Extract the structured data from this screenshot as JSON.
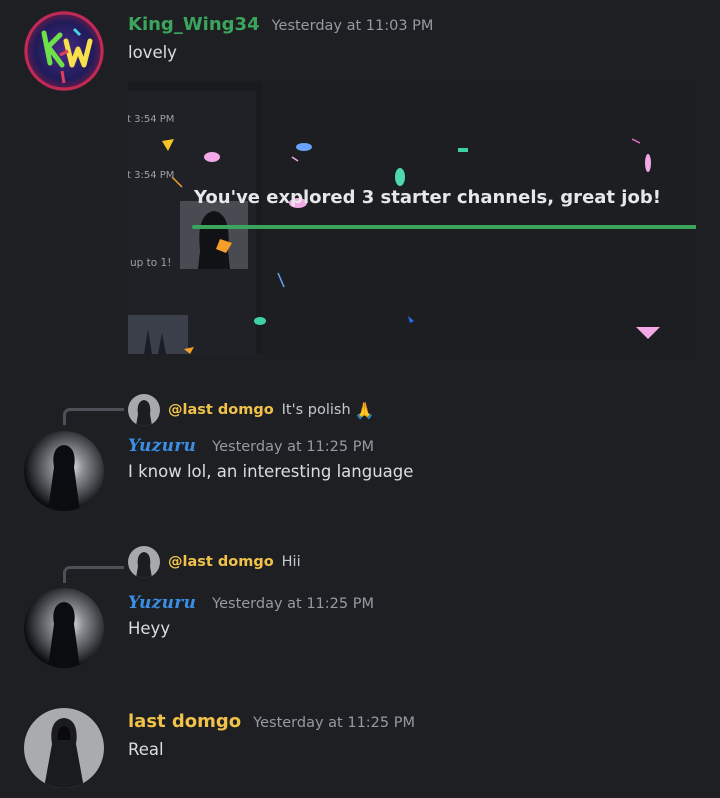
{
  "messages": [
    {
      "author": "King_Wing34",
      "author_color": "#3ba55c",
      "timestamp": "Yesterday at 11:03 PM",
      "text": "lovely",
      "attachment": {
        "side_timestamps": [
          "t 3:54 PM",
          "t 3:54 PM"
        ],
        "side_text": "up to 1!",
        "banner_text": "You've explored 3 starter channels, great job!",
        "progress": 1.0,
        "progress_color": "#3ba55c"
      }
    },
    {
      "reply": {
        "name": "@last domgo",
        "text": "It's polish",
        "emoji": "🙏"
      },
      "author": "Yuzuru",
      "author_color": "#3a8ee6",
      "timestamp": "Yesterday at 11:25 PM",
      "text": "I know lol, an interesting language"
    },
    {
      "reply": {
        "name": "@last domgo",
        "text": "Hii"
      },
      "author": "Yuzuru",
      "author_color": "#3a8ee6",
      "timestamp": "Yesterday at 11:25 PM",
      "text": "Heyy"
    },
    {
      "author": "last domgo",
      "author_color": "#f0c24a",
      "timestamp": "Yesterday at 11:25 PM",
      "text": "Real"
    }
  ]
}
